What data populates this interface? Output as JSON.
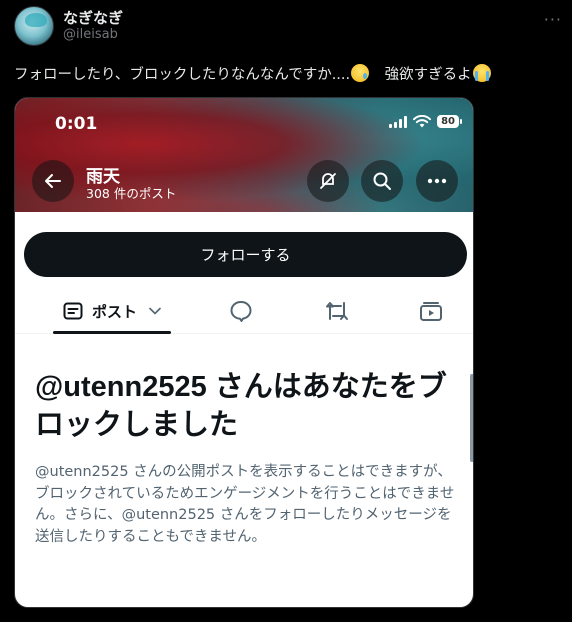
{
  "author": {
    "display_name": "なぎなぎ",
    "handle": "@ileisab"
  },
  "tweet": {
    "text_part1": "フォローしたり、ブロックしたりなんなんですか....",
    "text_part2": "　強欲すぎるよ",
    "emoji_1": "face-holding-back-tears",
    "emoji_2": "loudly-crying-face"
  },
  "screenshot": {
    "status_bar": {
      "time": "0:01",
      "battery": "80"
    },
    "header": {
      "title": "雨天",
      "post_count": "308 件のポスト"
    },
    "follow_button": "フォローする",
    "tabs": {
      "posts_label": "ポスト",
      "icons": [
        "replies-icon",
        "repost-icon",
        "media-icon"
      ]
    },
    "blocked": {
      "title": "@utenn2525 さんはあなたをブロックしました",
      "body": "@utenn2525 さんの公開ポストを表示することはできますが、ブロックされているためエンゲージメントを行うことはできません。さらに、@utenn2525 さんをフォローしたりメッセージを送信したりすることもできません。"
    }
  },
  "colors": {
    "background": "#000000",
    "text_primary": "#e7e9ea",
    "text_secondary": "#71767b",
    "follow_button_bg": "#0f1419"
  }
}
